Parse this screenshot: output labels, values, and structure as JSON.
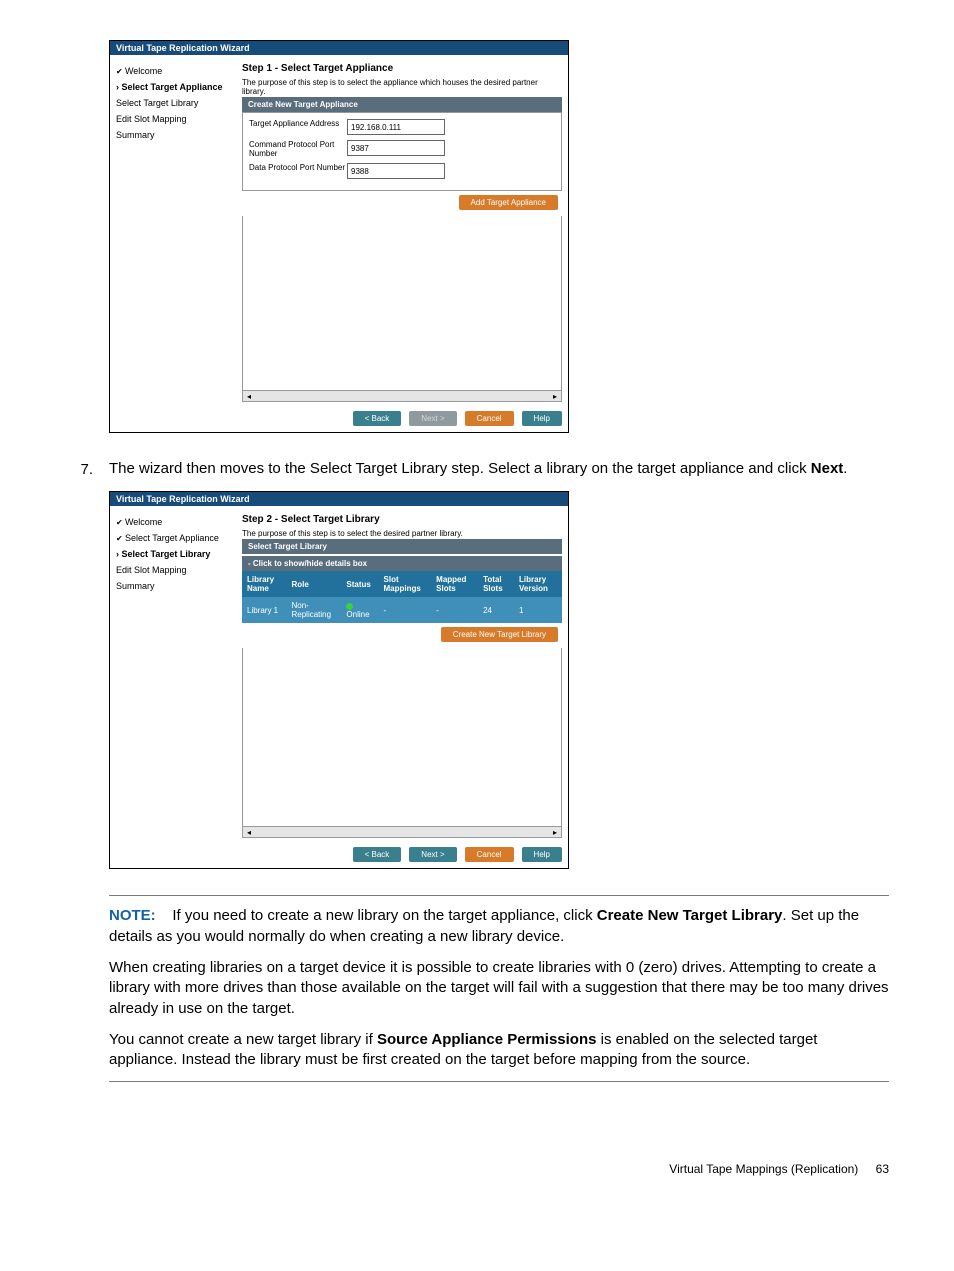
{
  "wiz_title": "Virtual Tape Replication Wizard",
  "sidebar": {
    "welcome": "Welcome",
    "select_target_app": "Select Target Appliance",
    "select_target_lib": "Select Target Library",
    "edit_slot": "Edit Slot Mapping",
    "summary": "Summary"
  },
  "step1": {
    "heading": "Step 1 - Select Target Appliance",
    "purpose": "The purpose of this step is to select the appliance which houses the desired partner library.",
    "bar": "Create New Target Appliance",
    "f1_label": "Target Appliance Address",
    "f1_value": "192.168.0.111",
    "f2_label": "Command Protocol Port Number",
    "f2_value": "9387",
    "f3_label": "Data Protocol Port Number",
    "f3_value": "9388",
    "add_btn": "Add Target Appliance"
  },
  "step2": {
    "heading": "Step 2 - Select Target Library",
    "purpose": "The purpose of this step is to select the desired partner library.",
    "bar1": "Select Target Library",
    "bar2": "- Click to show/hide details box",
    "th": [
      "Library Name",
      "Role",
      "Status",
      "Slot Mappings",
      "Mapped Slots",
      "Total Slots",
      "Library Version"
    ],
    "row": {
      "name": "Library 1",
      "role": "Non-Replicating",
      "status": "Online",
      "slotmap": "-",
      "mapped": "-",
      "total": "24",
      "ver": "1"
    },
    "create_btn": "Create New Target Library"
  },
  "nav": {
    "back": "< Back",
    "next": "Next >",
    "cancel": "Cancel",
    "help": "Help"
  },
  "s7_num": "7.",
  "s7_text_a": "The wizard then moves to the Select Target Library step. Select a library on the target appliance and click ",
  "s7_text_b": "Next",
  "s7_text_c": ".",
  "note_label": "NOTE:",
  "note_p1a": "If you need to create a new library on the target appliance, click ",
  "note_p1b": "Create New Target Library",
  "note_p1c": ". Set up the details as you would normally do when creating a new library device.",
  "note_p2": "When creating libraries on a target device it is possible to create libraries with 0 (zero) drives. Attempting to create a library with more drives than those available on the target will fail with a suggestion that there may be too many drives already in use on the target.",
  "note_p3a": "You cannot create a new target library if ",
  "note_p3b": "Source Appliance Permissions",
  "note_p3c": " is enabled on the selected target appliance. Instead the library must be first created on the target before mapping from the source.",
  "footer_title": "Virtual Tape Mappings (Replication)",
  "footer_page": "63"
}
